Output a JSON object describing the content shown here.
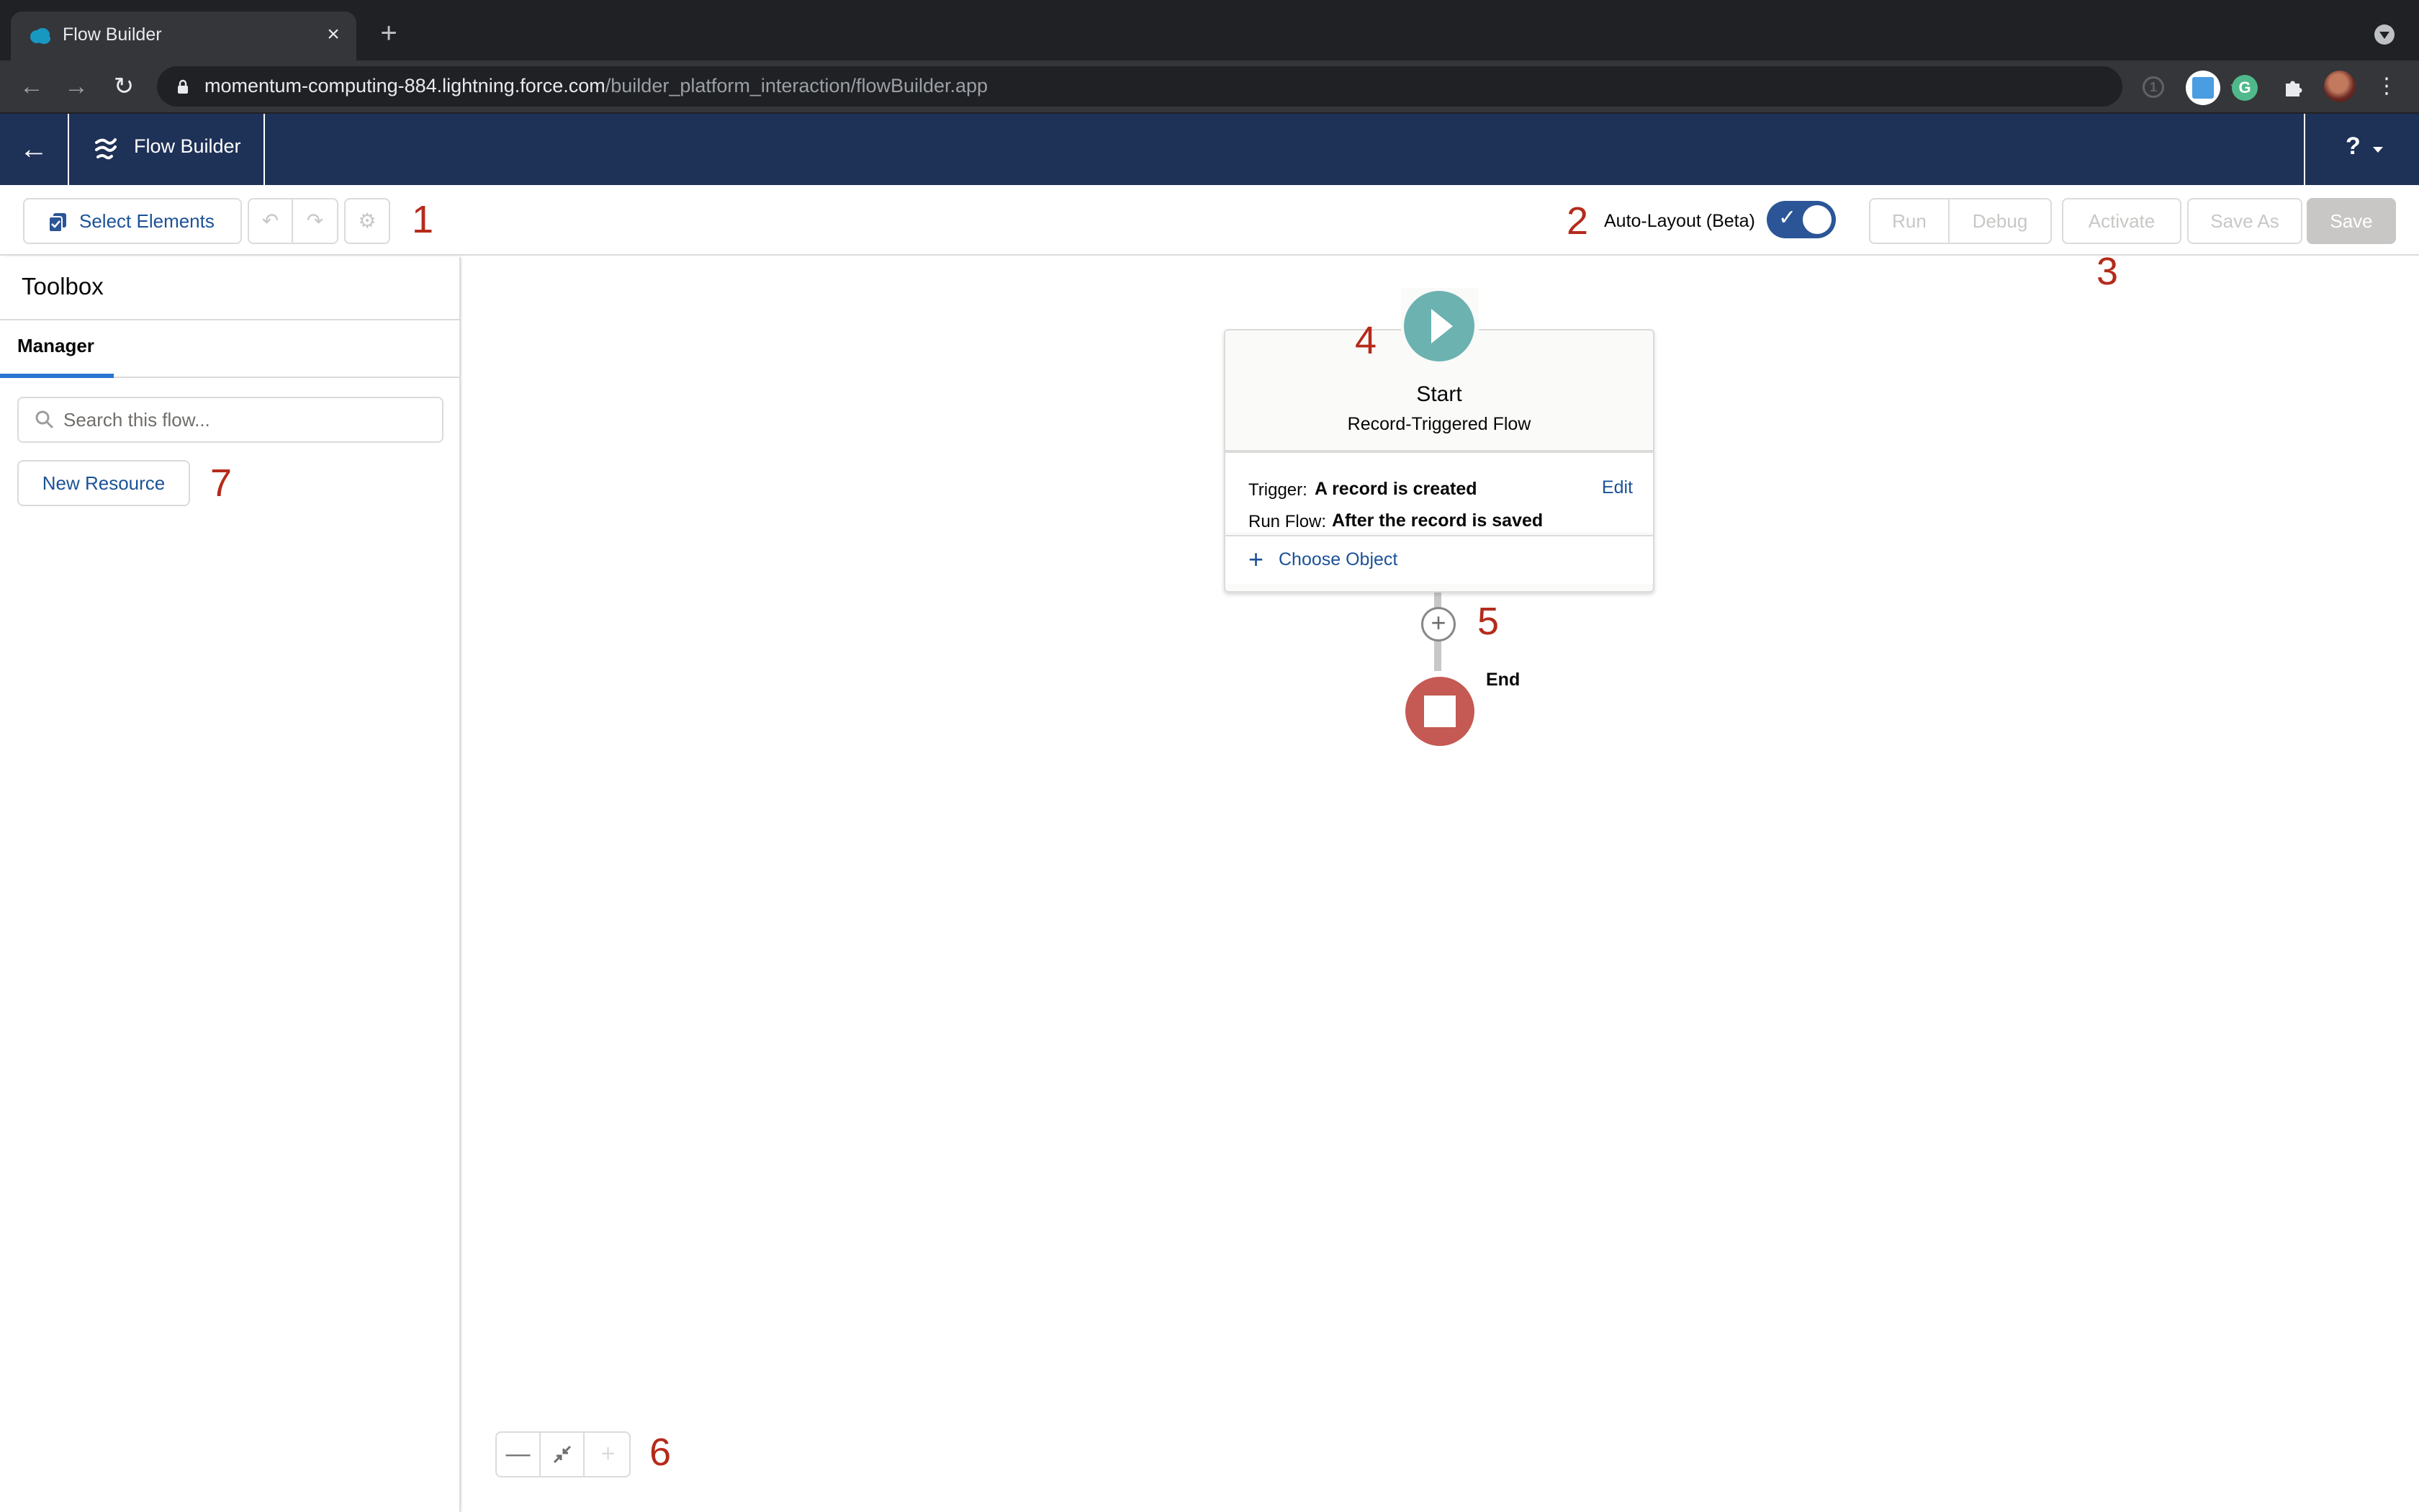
{
  "browser": {
    "tab_title": "Flow Builder",
    "tab_favicon": "salesforce-cloud-icon",
    "close_glyph": "×",
    "new_tab_glyph": "+",
    "url_host": "momentum-computing-884.lightning.force.com",
    "url_path": "/builder_platform_interaction/flowBuilder.app",
    "back_glyph": "←",
    "forward_glyph": "→",
    "reload_glyph": "↻",
    "star_glyph": "☆",
    "extensions": [
      "1password-icon",
      "search-people-extension-icon",
      "grammarly-icon",
      "extensions-puzzle-icon",
      "profile-avatar"
    ],
    "grammarly_glyph": "G",
    "puzzle_glyph": "✚",
    "menu_glyph": "⋮",
    "onepw_glyph": "1"
  },
  "header": {
    "back_glyph": "←",
    "app_name": "Flow Builder",
    "help_glyph": "?"
  },
  "toolbar": {
    "select_elements": "Select Elements",
    "undo_glyph": "↶",
    "redo_glyph": "↷",
    "settings_glyph": "⚙",
    "auto_layout_label": "Auto-Layout (Beta)",
    "auto_layout_on": true,
    "toggle_check": "✓",
    "run": "Run",
    "debug": "Debug",
    "activate": "Activate",
    "save_as": "Save As",
    "save": "Save"
  },
  "sidebar": {
    "title": "Toolbox",
    "tabs": [
      {
        "label": "Manager",
        "active": true
      }
    ],
    "search_placeholder": "Search this flow...",
    "new_resource": "New Resource"
  },
  "canvas": {
    "start": {
      "title": "Start",
      "subtitle": "Record-Triggered Flow",
      "trigger_label": "Trigger:",
      "trigger_value": "A record is created",
      "run_label": "Run Flow:",
      "run_value": "After the record is saved",
      "edit": "Edit",
      "choose_plus": "+",
      "choose_object": "Choose Object"
    },
    "add_glyph": "+",
    "end_label": "End",
    "zoom": {
      "out_glyph": "—",
      "fit_glyph": "⤡",
      "in_glyph": "+"
    }
  },
  "annotations": [
    "1",
    "2",
    "3",
    "4",
    "5",
    "6",
    "7"
  ],
  "colors": {
    "header_bg": "#1e3157",
    "brand_blue": "#1b5297",
    "start_teal": "#6cb2b0",
    "end_red": "#c55953",
    "annotation_red": "#b52a1a",
    "toggle_blue": "#2b5597"
  }
}
